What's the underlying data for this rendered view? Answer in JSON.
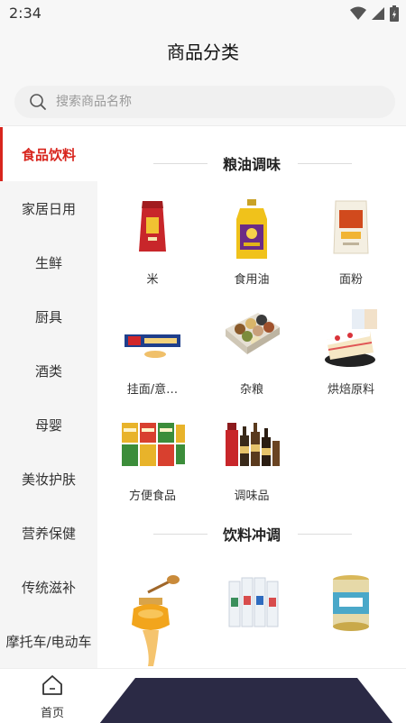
{
  "status": {
    "time": "2:34"
  },
  "header": {
    "title": "商品分类"
  },
  "search": {
    "placeholder": "搜索商品名称"
  },
  "sidebar": {
    "items": [
      {
        "label": "食品饮料",
        "active": true
      },
      {
        "label": "家居日用"
      },
      {
        "label": "生鲜"
      },
      {
        "label": "厨具"
      },
      {
        "label": "酒类"
      },
      {
        "label": "母婴"
      },
      {
        "label": "美妆护肤"
      },
      {
        "label": "营养保健"
      },
      {
        "label": "传统滋补"
      },
      {
        "label": "摩托车/电动车"
      }
    ]
  },
  "sections": [
    {
      "title": "粮油调味",
      "items": [
        {
          "label": "米",
          "icon": "rice-bag-icon"
        },
        {
          "label": "食用油",
          "icon": "oil-bottle-icon"
        },
        {
          "label": "面粉",
          "icon": "flour-bag-icon"
        },
        {
          "label": "挂面/意…",
          "icon": "pasta-box-icon"
        },
        {
          "label": "杂粮",
          "icon": "grains-tray-icon"
        },
        {
          "label": "烘焙原料",
          "icon": "cake-icon"
        },
        {
          "label": "方便食品",
          "icon": "instant-noodles-icon"
        },
        {
          "label": "调味品",
          "icon": "condiment-bottles-icon"
        }
      ]
    },
    {
      "title": "饮料冲调",
      "items": [
        {
          "label": "",
          "icon": "honey-jar-icon"
        },
        {
          "label": "",
          "icon": "milk-bottles-icon"
        },
        {
          "label": "",
          "icon": "milk-powder-can-icon"
        }
      ]
    }
  ],
  "tabbar": {
    "home_label": "首页"
  },
  "colors": {
    "accent": "#d8251d",
    "sidebar_bg": "#f5f5f5",
    "nav_shape": "#2b2a45"
  }
}
